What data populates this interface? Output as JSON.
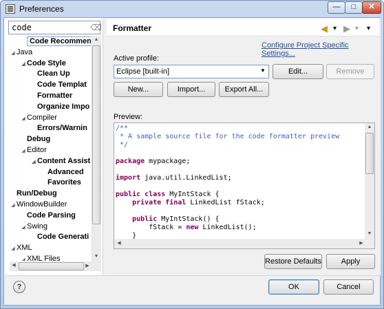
{
  "window": {
    "title": "Preferences",
    "min_label": "—",
    "max_label": "□",
    "close_label": "✕"
  },
  "filter": {
    "value": "code",
    "clear_icon": "clear-filter-icon"
  },
  "tree": {
    "items": [
      {
        "label": "Code Recommenders",
        "level": 1,
        "bold": true,
        "selected": true,
        "twisty": ""
      },
      {
        "label": "Java",
        "level": 0,
        "bold": false,
        "twisty": "◢"
      },
      {
        "label": "Code Style",
        "level": 1,
        "bold": true,
        "twisty": "◢"
      },
      {
        "label": "Clean Up",
        "level": 2,
        "bold": true,
        "twisty": ""
      },
      {
        "label": "Code Templat",
        "level": 2,
        "bold": true,
        "twisty": ""
      },
      {
        "label": "Formatter",
        "level": 2,
        "bold": true,
        "twisty": ""
      },
      {
        "label": "Organize Impo",
        "level": 2,
        "bold": true,
        "twisty": ""
      },
      {
        "label": "Compiler",
        "level": 1,
        "bold": false,
        "twisty": "◢"
      },
      {
        "label": "Errors/Warnin",
        "level": 2,
        "bold": true,
        "twisty": ""
      },
      {
        "label": "Debug",
        "level": 1,
        "bold": true,
        "twisty": ""
      },
      {
        "label": "Editor",
        "level": 1,
        "bold": false,
        "twisty": "◢"
      },
      {
        "label": "Content Assist",
        "level": 2,
        "bold": true,
        "twisty": "◢"
      },
      {
        "label": "Advanced",
        "level": 3,
        "bold": true,
        "twisty": ""
      },
      {
        "label": "Favorites",
        "level": 3,
        "bold": true,
        "twisty": ""
      },
      {
        "label": "Run/Debug",
        "level": 0,
        "bold": true,
        "twisty": ""
      },
      {
        "label": "WindowBuilder",
        "level": 0,
        "bold": false,
        "twisty": "◢"
      },
      {
        "label": "Code Parsing",
        "level": 1,
        "bold": true,
        "twisty": ""
      },
      {
        "label": "Swing",
        "level": 1,
        "bold": false,
        "twisty": "◢"
      },
      {
        "label": "Code Generati",
        "level": 2,
        "bold": true,
        "twisty": ""
      },
      {
        "label": "XML",
        "level": 0,
        "bold": false,
        "twisty": "◢"
      },
      {
        "label": "XML Files",
        "level": 1,
        "bold": false,
        "twisty": "◢"
      }
    ]
  },
  "page": {
    "title": "Formatter",
    "back_icon": "◀",
    "forward_icon": "▶",
    "dropdown_icon": "▾",
    "menu_icon": "▾",
    "configure_link": "Configure Project Specific Settings...",
    "active_profile_label": "Active profile:",
    "profile_value": "Eclipse [built-in]",
    "edit_label": "Edit...",
    "remove_label": "Remove",
    "new_label": "New...",
    "import_label": "Import...",
    "export_label": "Export All...",
    "preview_label": "Preview:",
    "restore_label": "Restore Defaults",
    "apply_label": "Apply"
  },
  "preview_code": [
    {
      "parts": [
        {
          "t": "/**",
          "c": "cm"
        }
      ]
    },
    {
      "parts": [
        {
          "t": " * A sample source file for the code formatter preview",
          "c": "cm"
        }
      ]
    },
    {
      "parts": [
        {
          "t": " */",
          "c": "cm"
        }
      ]
    },
    {
      "parts": []
    },
    {
      "parts": [
        {
          "t": "package",
          "c": "kw"
        },
        {
          "t": " mypackage;",
          "c": ""
        }
      ]
    },
    {
      "parts": []
    },
    {
      "parts": [
        {
          "t": "import",
          "c": "kw"
        },
        {
          "t": " java.util.LinkedList;",
          "c": ""
        }
      ]
    },
    {
      "parts": []
    },
    {
      "parts": [
        {
          "t": "public",
          "c": "kw"
        },
        {
          "t": " ",
          "c": ""
        },
        {
          "t": "class",
          "c": "kw"
        },
        {
          "t": " MyIntStack {",
          "c": ""
        }
      ]
    },
    {
      "parts": [
        {
          "t": "    ",
          "c": ""
        },
        {
          "t": "private",
          "c": "kw"
        },
        {
          "t": " ",
          "c": ""
        },
        {
          "t": "final",
          "c": "kw"
        },
        {
          "t": " LinkedList fStack;",
          "c": ""
        }
      ]
    },
    {
      "parts": []
    },
    {
      "parts": [
        {
          "t": "    ",
          "c": ""
        },
        {
          "t": "public",
          "c": "kw"
        },
        {
          "t": " MyIntStack() {",
          "c": ""
        }
      ]
    },
    {
      "parts": [
        {
          "t": "        fStack = ",
          "c": ""
        },
        {
          "t": "new",
          "c": "kw"
        },
        {
          "t": " LinkedList();",
          "c": ""
        }
      ]
    },
    {
      "parts": [
        {
          "t": "    }",
          "c": ""
        }
      ]
    }
  ],
  "footer": {
    "help_label": "?",
    "ok_label": "OK",
    "cancel_label": "Cancel"
  }
}
